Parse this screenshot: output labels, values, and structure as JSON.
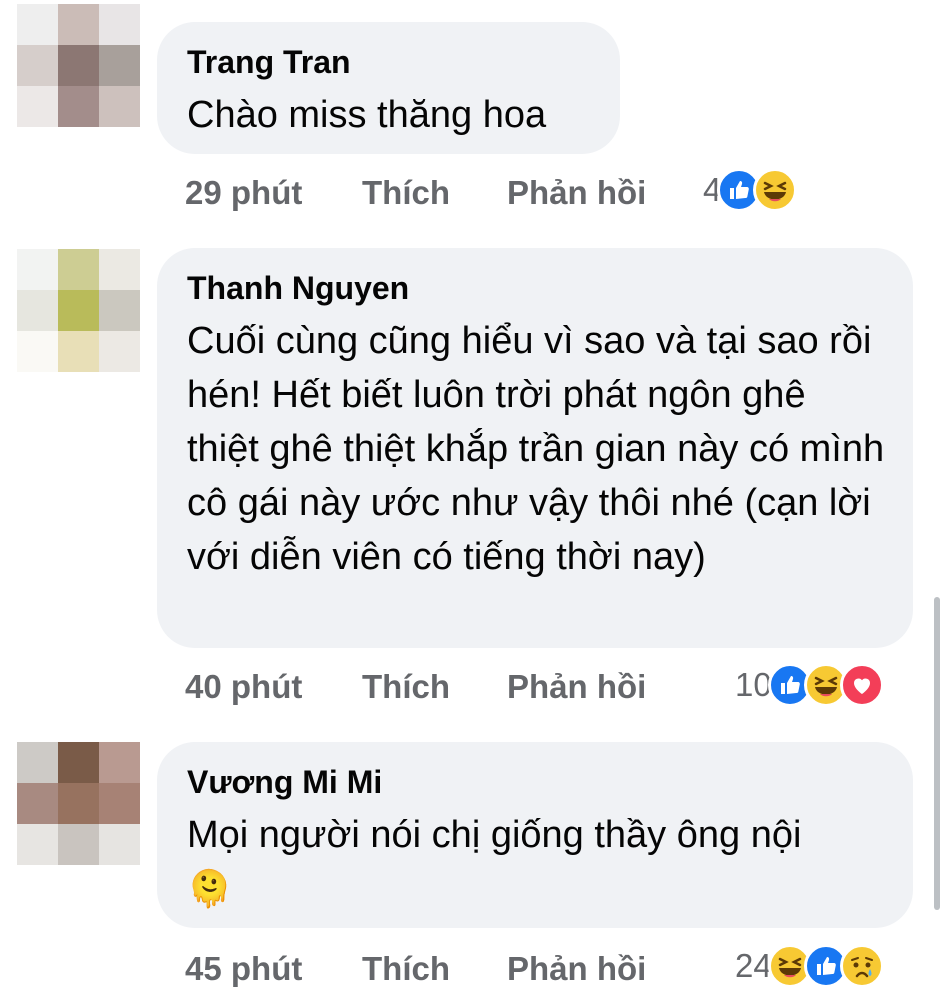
{
  "comments": [
    {
      "author": "Trang Tran",
      "text": "Chào miss thăng hoa",
      "time": "29 phút",
      "like_label": "Thích",
      "reply_label": "Phản hồi",
      "reaction_count": "4",
      "reactions": [
        "like-icon",
        "haha-icon"
      ],
      "avatar_colors": [
        "#eeeeee",
        "#cbbcb7",
        "#e8e5e6",
        "#d6cecb",
        "#8c7773",
        "#a8a09b",
        "#ece8e7",
        "#a38d8b",
        "#cdc1bd"
      ]
    },
    {
      "author": "Thanh Nguyen",
      "text": "Cuối cùng cũng hiểu vì sao và tại sao rồi hén! Hết biết luôn trời phát ngôn ghê thiệt ghê thiệt khắp trần gian này có mình cô gái này ước như vậy thôi nhé (cạn lời với diễn viên có tiếng thời nay)",
      "time": "40 phút",
      "like_label": "Thích",
      "reply_label": "Phản hồi",
      "reaction_count": "10",
      "reactions": [
        "like-icon",
        "haha-icon",
        "love-icon"
      ],
      "avatar_colors": [
        "#f2f3f2",
        "#cdcd93",
        "#ebe9e3",
        "#e6e6df",
        "#b9bb5a",
        "#cbc8bf",
        "#faf9f5",
        "#e8dfb7",
        "#ece9e4"
      ]
    },
    {
      "author": "Vương Mi Mi",
      "text": "Mọi người nói chị giống thầy ông nội",
      "emoji": "🫠",
      "time": "45 phút",
      "like_label": "Thích",
      "reply_label": "Phản hồi",
      "reaction_count": "24",
      "reactions": [
        "haha-icon",
        "like-icon",
        "sad-icon"
      ],
      "avatar_colors": [
        "#cdcac6",
        "#7a5b48",
        "#b99a91",
        "#a88a81",
        "#97725f",
        "#a78275",
        "#e7e5e2",
        "#c9c4bf",
        "#e6e4e1"
      ]
    }
  ],
  "colors": {
    "bubble": "#f0f2f5",
    "meta_text": "#65676b",
    "like": "#1877f2",
    "haha": "#f7c933",
    "love": "#f33e58"
  }
}
